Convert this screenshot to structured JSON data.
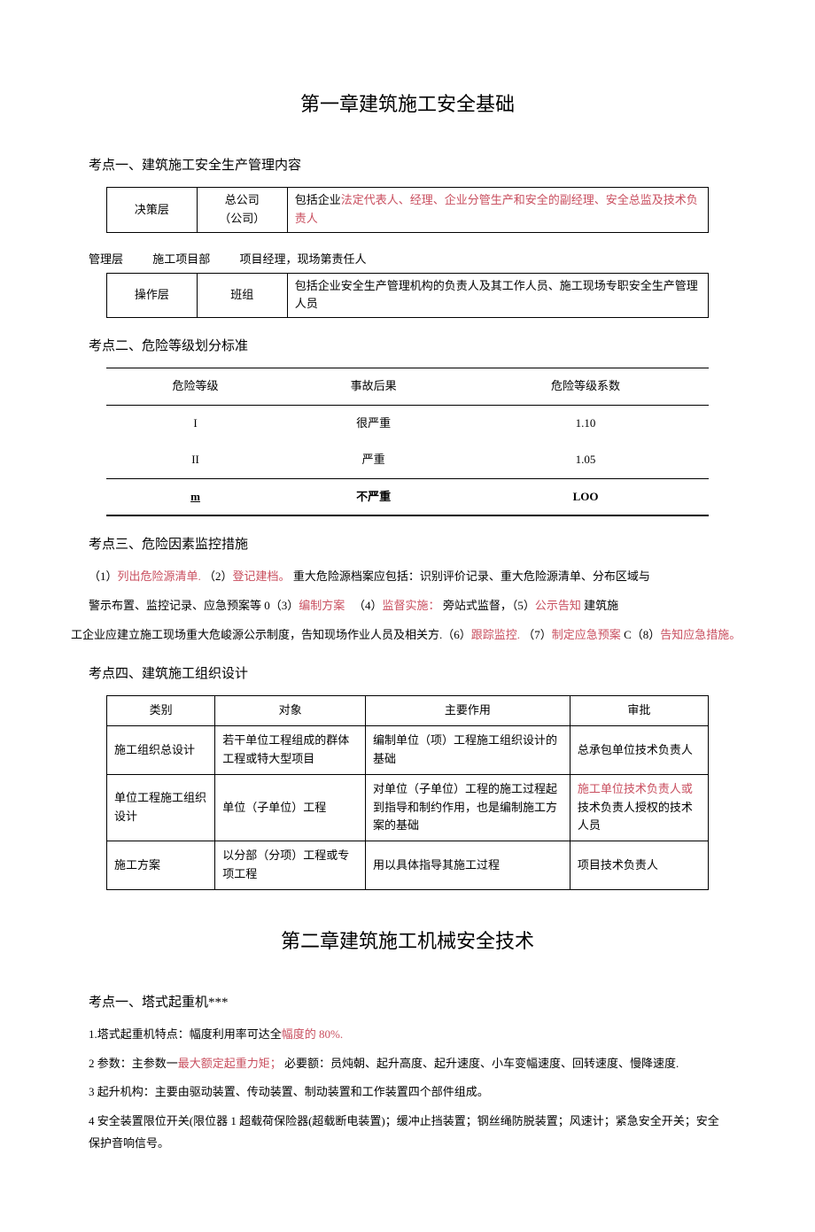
{
  "chapter1": {
    "title": "第一章建筑施工安全基础",
    "section1": {
      "heading": "考点一、建筑施工安全生产管理内容",
      "table1": {
        "r1c1": "决策层",
        "r1c2_line1": "总公司",
        "r1c2_line2": "（公司）",
        "r1c3_prefix": "包括企业",
        "r1c3_red": "法定代表人、经理、企业分管生产和安全的副经理、安全总监及技术负责人"
      },
      "midrow": {
        "a": "管理层",
        "b": "施工项目部",
        "c": "项目经理，现场第责任人"
      },
      "table1b": {
        "r1c1": "操作层",
        "r1c2": "班组",
        "r1c3": "包括企业安全生产管理机构的负责人及其工作人员、施工现场专职安全生产管理人员"
      }
    },
    "section2": {
      "heading": "考点二、危险等级划分标准",
      "headers": {
        "h1": "危险等级",
        "h2": "事故后果",
        "h3": "危险等级系数"
      },
      "rows": [
        {
          "c1": "I",
          "c2": "很严重",
          "c3": "1.10"
        },
        {
          "c1": "II",
          "c2": "严重",
          "c3": "1.05"
        },
        {
          "c1": "m",
          "c2": "不严重",
          "c3": "LOO"
        }
      ]
    },
    "section3": {
      "heading": "考点三、危险因素监控措施",
      "p1a": "（1）",
      "p1a_red": "列出危险源清单.",
      "p1b": "（2）",
      "p1b_red": "登记建档。",
      "p1c": "重大危险源档案应包括：识别评价记录、重大危险源清单、分布区域与",
      "p2a": "警示布置、监控记录、应急预案等 0（3）",
      "p2a_red": "编制方案",
      "p2b": "　（4）",
      "p2b_red": "监督实施：",
      "p2c": "旁站式监督，（5）",
      "p2c_red": "公示告知",
      "p2d": "建筑施",
      "p3a": "工企业应建立施工现场重大危峻源公示制度，告知现场作业人员及相关方.（6）",
      "p3a_red": "跟踪监控.",
      "p3b": "（7）",
      "p3b_red": "制定应急预案",
      "p3c": " C（8）",
      "p3c_red": "告知应急措施。"
    },
    "section4": {
      "heading": "考点四、建筑施工组织设计",
      "headers": {
        "h1": "类别",
        "h2": "对象",
        "h3": "主要作用",
        "h4": "审批"
      },
      "rows": [
        {
          "c1": "施工组织总设计",
          "c2": "若干单位工程组成的群体工程或特大型项目",
          "c3": "编制单位（项）工程施工组织设计的基础",
          "c4": "总承包单位技术负责人"
        },
        {
          "c1": "单位工程施工组织设计",
          "c2": "单位（子单位）工程",
          "c3": "对单位（子单位）工程的施工过程起到指导和制约作用，也是编制施工方案的基础",
          "c4_red": "施工单位技术负责人或",
          "c4_rest": "技术负责人授权的技术人员"
        },
        {
          "c1": "施工方案",
          "c2": "以分部（分项）工程或专项工程",
          "c3": "用以具体指导其施工过程",
          "c4": "项目技术负责人"
        }
      ]
    }
  },
  "chapter2": {
    "title": "第二章建筑施工机械安全技术",
    "section1": {
      "heading": "考点一、塔式起重机***",
      "p1a": "1.塔式起重机特点：幅度利用率可达全",
      "p1_red": "幅度的 80%.",
      "p2a": "2 参数：主参数一",
      "p2_red": "最大额定起重力矩；",
      "p2b": "必要额：员炖朝、起升高度、起升速度、小车变幅速度、回转速度、慢降速度.",
      "p3": "3 起升机构：主要由驱动装置、传动装置、制动装置和工作装置四个部件组成。",
      "p4": "4 安全装置限位开关(限位器 1 超载荷保险器(超载断电装置)；缓冲止挡装置；钢丝绳防脱装置；风速计；紧急安全开关；安全保护音响信号。"
    }
  }
}
